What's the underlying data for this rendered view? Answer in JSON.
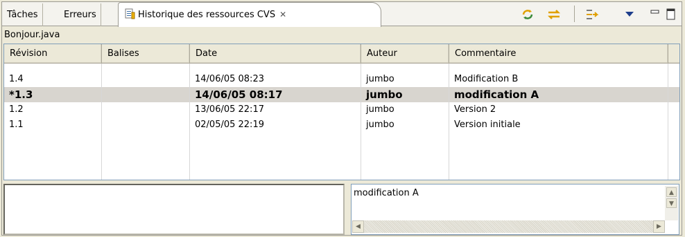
{
  "tabs": {
    "inactive": [
      {
        "label": "Tâches"
      },
      {
        "label": "Erreurs"
      }
    ],
    "active": {
      "label": "Historique des ressources CVS",
      "close_icon": "close-icon"
    }
  },
  "toolbar": {
    "icons": [
      "refresh-icon",
      "link-with-editor-icon",
      "group-by-date-icon",
      "view-menu-chevron-icon",
      "minimize-icon",
      "maximize-icon"
    ]
  },
  "resource": {
    "name": "Bonjour.java"
  },
  "table": {
    "columns": [
      "Révision",
      "Balises",
      "Date",
      "Auteur",
      "Commentaire"
    ],
    "rows": [
      {
        "revision": "1.4",
        "tags": "",
        "date": "14/06/05 08:23",
        "author": "jumbo",
        "comment": "Modification B",
        "selected": false
      },
      {
        "revision": "*1.3",
        "tags": "",
        "date": "14/06/05 08:17",
        "author": "jumbo",
        "comment": "modification A",
        "selected": true
      },
      {
        "revision": "1.2",
        "tags": "",
        "date": "13/06/05 22:17",
        "author": "jumbo",
        "comment": "Version 2",
        "selected": false
      },
      {
        "revision": "1.1",
        "tags": "",
        "date": "02/05/05 22:19",
        "author": "jumbo",
        "comment": "Version initiale",
        "selected": false
      }
    ]
  },
  "details": {
    "tags_text": "",
    "comment_text": "modification A"
  },
  "colors": {
    "selection": "#d8d5cf",
    "frame": "#ece9d8",
    "border": "#7f9db9"
  }
}
